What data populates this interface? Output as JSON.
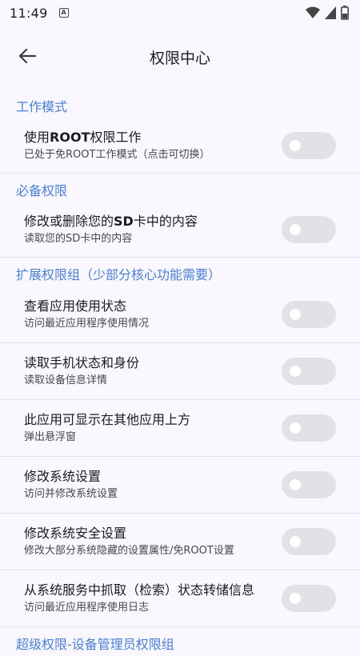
{
  "status_bar": {
    "time": "11:49",
    "notif_icon": "A"
  },
  "app_bar": {
    "title": "权限中心"
  },
  "sections": [
    {
      "header": "工作模式",
      "items": [
        {
          "title_parts": [
            "使用",
            "ROOT",
            "权限工作"
          ],
          "subtitle": "已处于免ROOT工作模式（点击可切换）",
          "enabled": false
        }
      ]
    },
    {
      "header": "必备权限",
      "items": [
        {
          "title_parts": [
            "修改或删除您的",
            "SD",
            "卡中的内容"
          ],
          "subtitle": "读取您的SD卡中的内容",
          "enabled": false
        }
      ]
    },
    {
      "header": "扩展权限组（少部分核心功能需要）",
      "items": [
        {
          "title": "查看应用使用状态",
          "subtitle": "访问最近应用程序使用情况",
          "enabled": false
        },
        {
          "title": "读取手机状态和身份",
          "subtitle": "读取设备信息详情",
          "enabled": false
        },
        {
          "title": "此应用可显示在其他应用上方",
          "subtitle": "弹出悬浮窗",
          "enabled": false
        },
        {
          "title": "修改系统设置",
          "subtitle": "访问并修改系统设置",
          "enabled": false
        },
        {
          "title": "修改系统安全设置",
          "subtitle": "修改大部分系统隐藏的设置属性/免ROOT设置",
          "enabled": false
        },
        {
          "title": "从系统服务中抓取（检索）状态转储信息",
          "subtitle": "访问最近应用程序使用日志",
          "enabled": false
        }
      ]
    },
    {
      "header": "超级权限-设备管理员权限组"
    }
  ]
}
